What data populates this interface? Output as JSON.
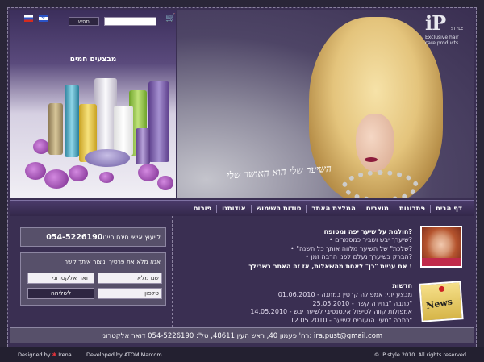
{
  "header": {
    "search_button": "חפש",
    "search_placeholder": "",
    "promo_title": "מבצעים חמים"
  },
  "hero": {
    "slogan": "השיער שלי הוא האושר שלי",
    "logo_mark": "iP",
    "logo_sub": "STYLE",
    "logo_line1": "Exclusive hair",
    "logo_line2": "care products"
  },
  "nav": {
    "items": [
      "דף הבית",
      "פתרונות",
      "מוצרים",
      "המלצת האתר",
      "סודות השימוש",
      "אודותנו",
      "פורום"
    ]
  },
  "contact": {
    "phone_label": "לייעוץ אישי חינם חייגו",
    "phone_number": "054-5226190",
    "form_title": "אנא מלא את פרטיך וניצור איתך קשר",
    "name_placeholder": "שם מלא",
    "email_placeholder": "דואר אלקטרוני",
    "phone_placeholder": "טלפון",
    "send_label": "לשליחה"
  },
  "dream": {
    "title": "חולמת על שיער יפה ומטופח?",
    "items": [
      "• שיערך יבש ושביר כמסמרים?",
      "• \"שלכת\" של השיער מלווה אותך כל השנה?",
      "• הברק בשיערך נעלם לפני הרבה זמן?"
    ],
    "cta": "אם עניית \"כן\" לאחת מהשאלות, אז זה האתר בשבילך !"
  },
  "news": {
    "icon_label": "News",
    "title": "חדשות",
    "items": [
      "01.06.2010 - מבצע יוני: אמפולה קרטין במתנה",
      "25.05.2010 - כתבה \"בחירה קשה\"",
      "14.05.2010 - אמפולות קווה לטיפול אינטנסיבי לשיער יבש",
      "12.05.2010 - כתבה \"מעין הנעורים לשיער\""
    ]
  },
  "address_bar": "רח' פעמון 40, ראש העין 48611, טל': 054-5226190 דואר אלקטרוני: ira.pust@gmail.com",
  "footer": {
    "designed_label": "Designed by",
    "designed_name": "Irena",
    "developed_label": "Developed by",
    "developed_name": "ATOM Marcom",
    "copyright": "© IP style 2010. All rights reserved"
  }
}
